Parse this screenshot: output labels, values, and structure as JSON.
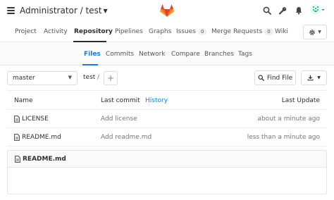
{
  "header": {
    "project_title": "Administrator / test",
    "icons": [
      "menu-icon",
      "gitlab-logo",
      "search-icon",
      "wrench-icon",
      "bell-icon",
      "avatar"
    ]
  },
  "project_nav": {
    "items": [
      {
        "label": "Project"
      },
      {
        "label": "Activity"
      },
      {
        "label": "Repository",
        "active": true
      },
      {
        "label": "Pipelines"
      },
      {
        "label": "Graphs"
      },
      {
        "label": "Issues",
        "count": "0"
      },
      {
        "label": "Merge Requests",
        "count": "0"
      },
      {
        "label": "Wiki"
      }
    ]
  },
  "sub_nav": {
    "items": [
      {
        "label": "Files",
        "active": true
      },
      {
        "label": "Commits"
      },
      {
        "label": "Network"
      },
      {
        "label": "Compare"
      },
      {
        "label": "Branches"
      },
      {
        "label": "Tags"
      }
    ]
  },
  "tree": {
    "branch": "master",
    "path": "test",
    "separator": "/",
    "find_file_label": "Find File"
  },
  "table": {
    "headers": {
      "name": "Name",
      "last_commit": "Last commit",
      "history": "History",
      "last_update": "Last Update"
    },
    "rows": [
      {
        "name": "LICENSE",
        "commit": "Add license",
        "date": "about a minute ago"
      },
      {
        "name": "README.md",
        "commit": "Add readme.md",
        "date": "less than a minute ago"
      }
    ]
  },
  "readme": {
    "title": "README.md"
  },
  "colors": {
    "accent": "#1f78d1",
    "gitlab_orange": "#fc6d26",
    "gitlab_red": "#e24329",
    "gitlab_light": "#fca326"
  }
}
